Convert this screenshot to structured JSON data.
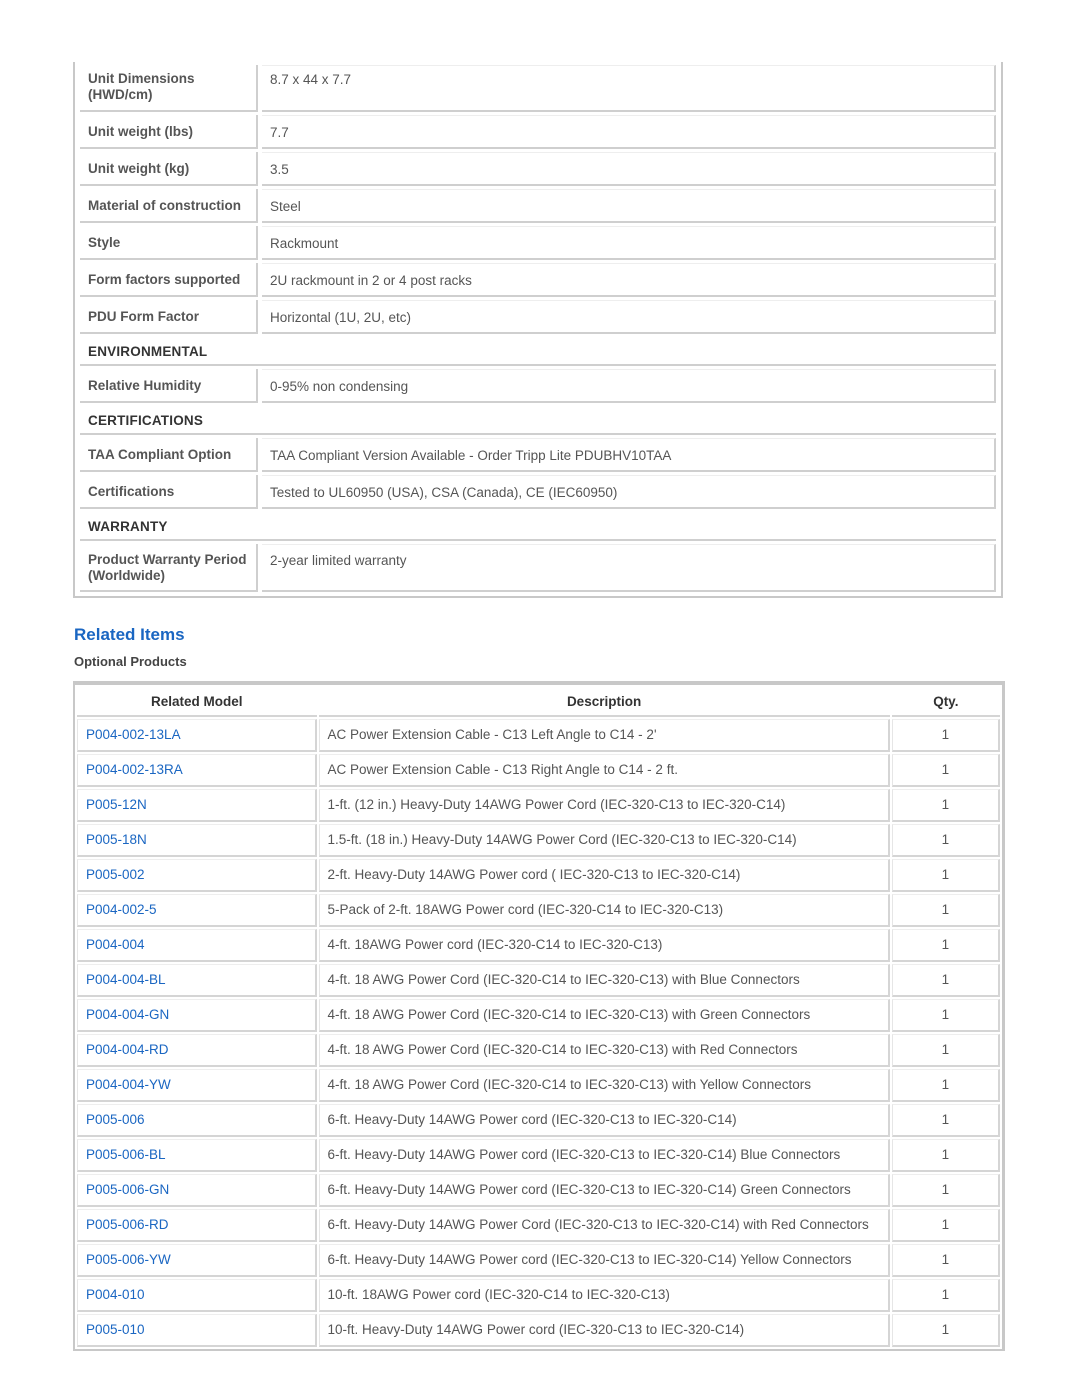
{
  "specs": {
    "rows_top": [
      {
        "label": "Unit Dimensions (HWD/cm)",
        "value": "8.7 x 44 x 7.7"
      },
      {
        "label": "Unit weight (lbs)",
        "value": "7.7"
      },
      {
        "label": "Unit weight (kg)",
        "value": "3.5"
      },
      {
        "label": "Material of construction",
        "value": "Steel"
      },
      {
        "label": "Style",
        "value": "Rackmount"
      },
      {
        "label": "Form factors supported",
        "value": "2U rackmount in 2 or 4 post racks"
      },
      {
        "label": "PDU Form Factor",
        "value": "Horizontal (1U, 2U, etc)"
      }
    ],
    "environmental": {
      "title": "ENVIRONMENTAL",
      "rows": [
        {
          "label": "Relative Humidity",
          "value": "0-95% non condensing"
        }
      ]
    },
    "certifications": {
      "title": "CERTIFICATIONS",
      "rows": [
        {
          "label": "TAA Compliant Option",
          "value": "TAA Compliant Version Available - Order Tripp Lite PDUBHV10TAA"
        },
        {
          "label": "Certifications",
          "value": "Tested to UL60950 (USA), CSA (Canada), CE (IEC60950)"
        }
      ]
    },
    "warranty": {
      "title": "WARRANTY",
      "rows": [
        {
          "label": "Product Warranty Period (Worldwide)",
          "value": "2-year limited warranty"
        }
      ]
    }
  },
  "related": {
    "title": "Related Items",
    "subtitle": "Optional Products",
    "columns": [
      "Related Model",
      "Description",
      "Qty."
    ],
    "link_color": "#1a66c2",
    "rows": [
      {
        "model": "P004-002-13LA",
        "description": "AC Power Extension Cable - C13 Left Angle to C14 - 2'",
        "qty": "1"
      },
      {
        "model": "P004-002-13RA",
        "description": "AC Power Extension Cable - C13 Right Angle to C14 - 2 ft.",
        "qty": "1"
      },
      {
        "model": "P005-12N",
        "description": "1-ft. (12 in.) Heavy-Duty 14AWG Power Cord (IEC-320-C13 to IEC-320-C14)",
        "qty": "1"
      },
      {
        "model": "P005-18N",
        "description": "1.5-ft. (18 in.) Heavy-Duty 14AWG Power Cord (IEC-320-C13 to IEC-320-C14)",
        "qty": "1"
      },
      {
        "model": "P005-002",
        "description": "2-ft. Heavy-Duty 14AWG Power cord ( IEC-320-C13 to IEC-320-C14)",
        "qty": "1"
      },
      {
        "model": "P004-002-5",
        "description": "5-Pack of 2-ft. 18AWG Power cord (IEC-320-C14 to IEC-320-C13)",
        "qty": "1"
      },
      {
        "model": "P004-004",
        "description": "4-ft. 18AWG Power cord (IEC-320-C14 to IEC-320-C13)",
        "qty": "1"
      },
      {
        "model": "P004-004-BL",
        "description": "4-ft. 18 AWG Power Cord (IEC-320-C14 to IEC-320-C13) with Blue Connectors",
        "qty": "1"
      },
      {
        "model": "P004-004-GN",
        "description": "4-ft. 18 AWG Power Cord (IEC-320-C14 to IEC-320-C13) with Green Connectors",
        "qty": "1"
      },
      {
        "model": "P004-004-RD",
        "description": "4-ft. 18 AWG Power Cord (IEC-320-C14 to IEC-320-C13) with Red Connectors",
        "qty": "1"
      },
      {
        "model": "P004-004-YW",
        "description": "4-ft. 18 AWG Power Cord (IEC-320-C14 to IEC-320-C13) with Yellow Connectors",
        "qty": "1"
      },
      {
        "model": "P005-006",
        "description": "6-ft. Heavy-Duty 14AWG Power cord (IEC-320-C13 to IEC-320-C14)",
        "qty": "1"
      },
      {
        "model": "P005-006-BL",
        "description": "6-ft. Heavy-Duty 14AWG Power cord (IEC-320-C13 to IEC-320-C14) Blue Connectors",
        "qty": "1"
      },
      {
        "model": "P005-006-GN",
        "description": "6-ft. Heavy-Duty 14AWG Power cord (IEC-320-C13 to IEC-320-C14) Green Connectors",
        "qty": "1"
      },
      {
        "model": "P005-006-RD",
        "description": "6-ft. Heavy-Duty 14AWG Power Cord (IEC-320-C13 to IEC-320-C14) with Red Connectors",
        "qty": "1"
      },
      {
        "model": "P005-006-YW",
        "description": "6-ft. Heavy-Duty 14AWG Power cord (IEC-320-C13 to IEC-320-C14) Yellow Connectors",
        "qty": "1"
      },
      {
        "model": "P004-010",
        "description": "10-ft. 18AWG Power cord (IEC-320-C14 to IEC-320-C13)",
        "qty": "1"
      },
      {
        "model": "P005-010",
        "description": "10-ft. Heavy-Duty 14AWG Power cord (IEC-320-C13 to IEC-320-C14)",
        "qty": "1"
      }
    ]
  }
}
